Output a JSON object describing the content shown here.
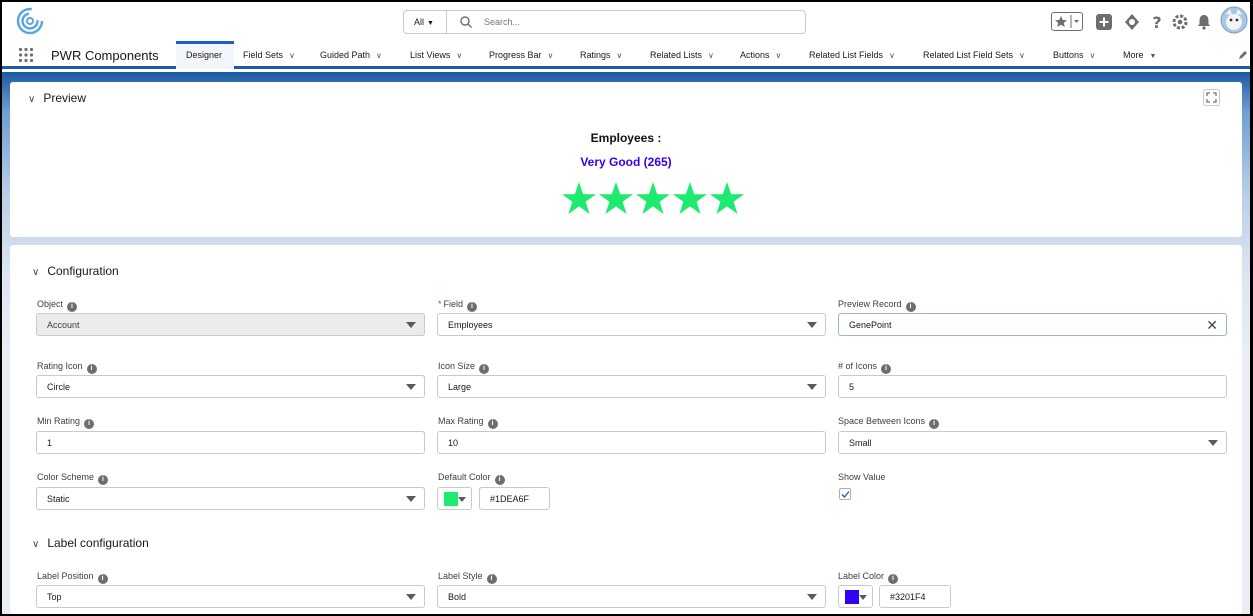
{
  "header": {
    "search_scope": "All",
    "search_placeholder": "Search..."
  },
  "nav": {
    "app_name": "PWR Components",
    "tabs": [
      {
        "label": "Designer",
        "active": true,
        "dropdown": false
      },
      {
        "label": "Field Sets",
        "dropdown": true
      },
      {
        "label": "Guided Path",
        "dropdown": true
      },
      {
        "label": "List Views",
        "dropdown": true
      },
      {
        "label": "Progress Bar",
        "dropdown": true
      },
      {
        "label": "Ratings",
        "dropdown": true
      },
      {
        "label": "Related Lists",
        "dropdown": true
      },
      {
        "label": "Actions",
        "dropdown": true
      },
      {
        "label": "Related List Fields",
        "dropdown": true
      },
      {
        "label": "Related List Field Sets",
        "dropdown": true
      },
      {
        "label": "Buttons",
        "dropdown": true
      },
      {
        "label": "More",
        "dropdown": true
      }
    ]
  },
  "preview": {
    "section_title": "Preview",
    "label": "Employees :",
    "value": "Very Good (265)",
    "value_color": "#3201F4",
    "icon_color": "#1DEA6F",
    "icon_count": 5
  },
  "configuration": {
    "section_title": "Configuration",
    "object": {
      "label": "Object",
      "value": "Account"
    },
    "field": {
      "label": "Field",
      "required_mark": "*",
      "value": "Employees"
    },
    "preview_record": {
      "label": "Preview Record",
      "value": "GenePoint"
    },
    "rating_icon": {
      "label": "Rating Icon",
      "value": "Circle"
    },
    "icon_size": {
      "label": "Icon Size",
      "value": "Large"
    },
    "num_icons": {
      "label": "# of Icons",
      "value": "5"
    },
    "min_rating": {
      "label": "Min Rating",
      "value": "1"
    },
    "max_rating": {
      "label": "Max Rating",
      "value": "10"
    },
    "space_between": {
      "label": "Space Between Icons",
      "value": "Small"
    },
    "color_scheme": {
      "label": "Color Scheme",
      "value": "Static"
    },
    "default_color": {
      "label": "Default Color",
      "value": "#1DEA6F",
      "swatch": "#1DEA6F"
    },
    "show_value": {
      "label": "Show Value",
      "checked": true
    }
  },
  "label_configuration": {
    "section_title": "Label configuration",
    "label_position": {
      "label": "Label Position",
      "value": "Top"
    },
    "label_style": {
      "label": "Label Style",
      "value": "Bold"
    },
    "label_color": {
      "label": "Label Color",
      "value": "#3201F4",
      "swatch": "#3201F4"
    }
  }
}
